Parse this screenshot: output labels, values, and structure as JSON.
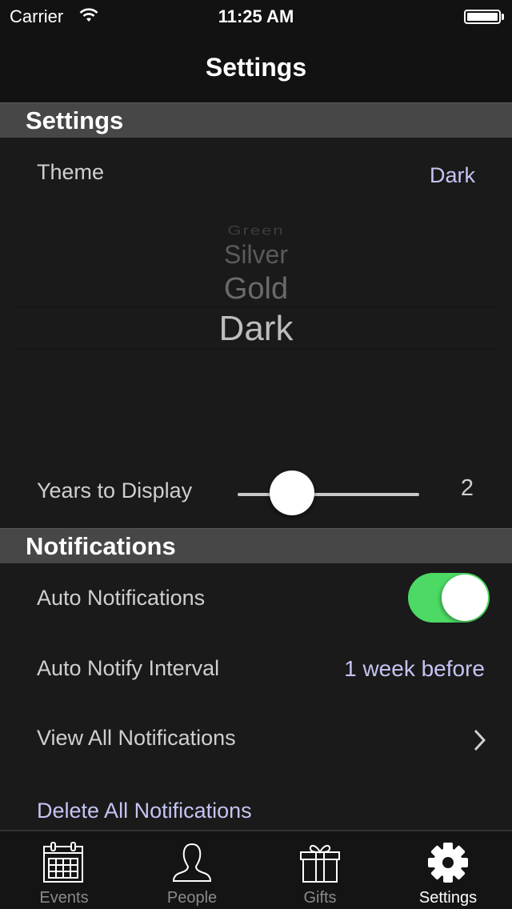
{
  "status_bar": {
    "carrier": "Carrier",
    "time": "11:25 AM",
    "battery_level_percent": 100
  },
  "nav": {
    "title": "Settings"
  },
  "sections": {
    "settings": {
      "header": "Settings",
      "theme": {
        "label": "Theme",
        "value": "Dark",
        "picker_options": [
          "Green",
          "Silver",
          "Gold",
          "Dark"
        ],
        "selected": "Dark"
      },
      "years_to_display": {
        "label": "Years to Display",
        "value": "2",
        "slider_fraction": 0.25
      }
    },
    "notifications": {
      "header": "Notifications",
      "auto_notifications": {
        "label": "Auto Notifications",
        "enabled": true
      },
      "auto_notify_interval": {
        "label": "Auto Notify Interval",
        "value": "1 week before"
      },
      "view_all": {
        "label": "View All Notifications"
      },
      "delete_all": {
        "label": "Delete All Notifications"
      }
    }
  },
  "tabs": [
    {
      "label": "Events",
      "icon": "calendar-icon",
      "active": false
    },
    {
      "label": "People",
      "icon": "person-icon",
      "active": false
    },
    {
      "label": "Gifts",
      "icon": "gift-icon",
      "active": false
    },
    {
      "label": "Settings",
      "icon": "gear-icon",
      "active": true
    }
  ],
  "colors": {
    "accent": "#c4c4f4",
    "toggle_on": "#4cd964",
    "section_header_bg": "#474747",
    "background": "#1a1a1a"
  }
}
